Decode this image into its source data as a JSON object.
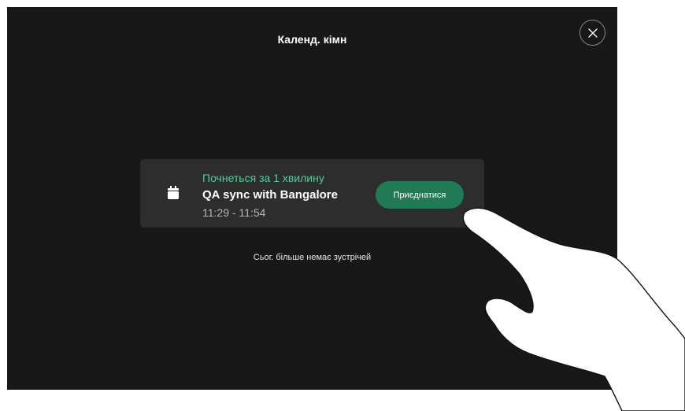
{
  "header": {
    "title": "Календ. кімн"
  },
  "icons": {
    "close": "close-icon",
    "calendar": "calendar-icon"
  },
  "meeting": {
    "status": "Почнеться за 1 хвилину",
    "title": "QA sync with Bangalore",
    "time": "11:29 - 11:54",
    "join_label": "Приєднатися"
  },
  "footer": {
    "no_more_meetings": "Сьог. більше немає зустрічей"
  },
  "colors": {
    "screen_bg": "#181818",
    "card_bg": "#2d2d2d",
    "accent_green": "#4ed09a",
    "join_button": "#1f7a55"
  }
}
